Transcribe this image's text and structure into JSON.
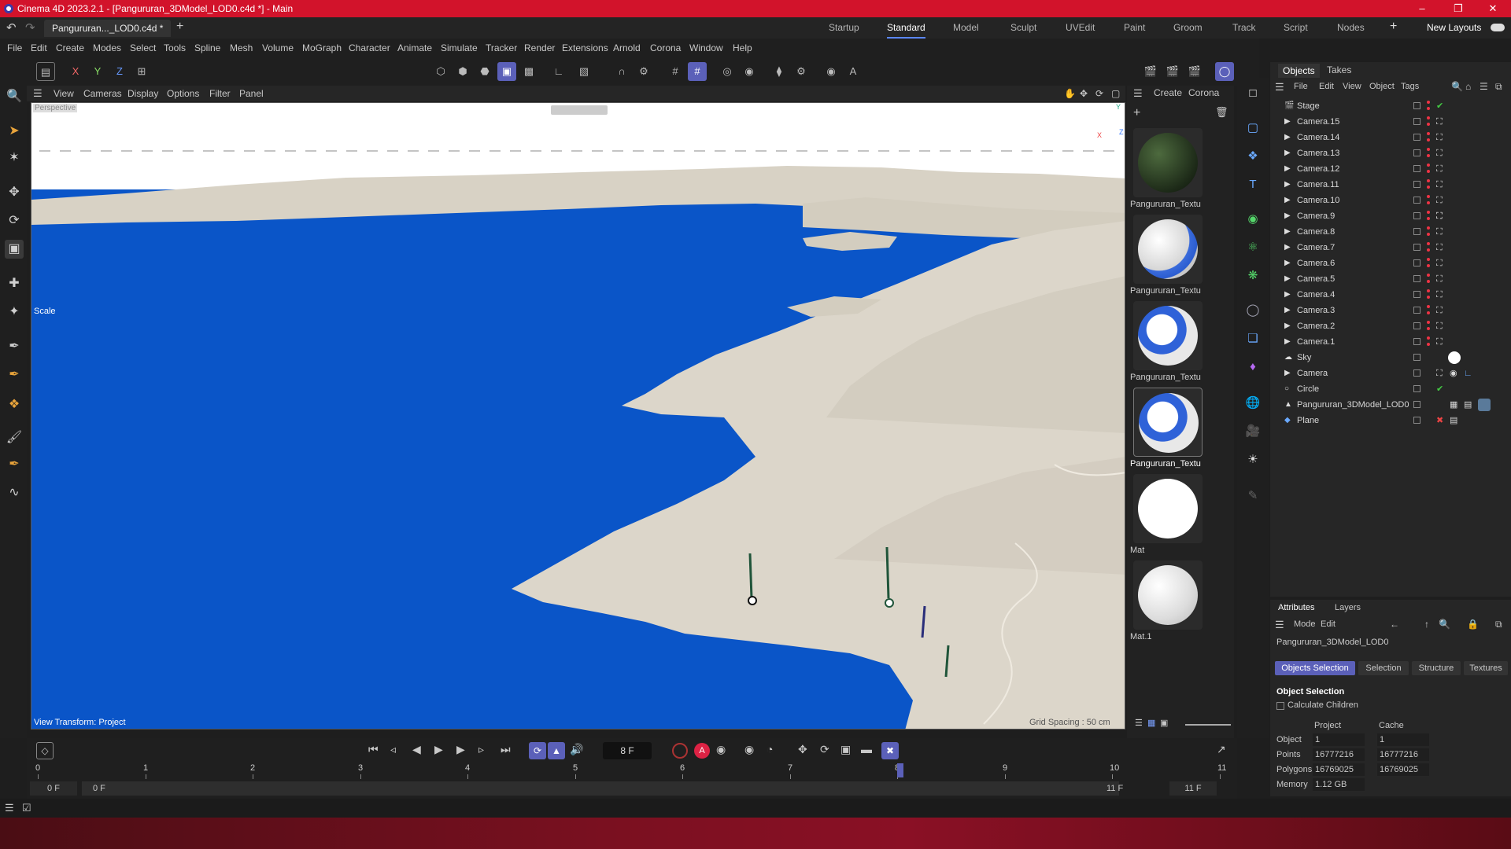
{
  "window": {
    "title": "Cinema 4D 2023.2.1 - [Pangururan_3DModel_LOD0.c4d *] - Main"
  },
  "tabs": {
    "doc_tab": "Pangururan..._LOD0.c4d *"
  },
  "layouts": {
    "items": [
      "Startup",
      "Standard",
      "Model",
      "Sculpt",
      "UVEdit",
      "Paint",
      "Groom",
      "Track",
      "Script",
      "Nodes"
    ],
    "active": "Standard",
    "new_layouts": "New Layouts"
  },
  "menu": {
    "items": [
      "File",
      "Edit",
      "Create",
      "Modes",
      "Select",
      "Tools",
      "Spline",
      "Mesh",
      "Volume",
      "MoGraph",
      "Character",
      "Animate",
      "Simulate",
      "Tracker",
      "Render",
      "Extensions",
      "Arnold",
      "Corona",
      "Window",
      "Help"
    ]
  },
  "axis_toolbar": {
    "x": "X",
    "y": "Y",
    "z": "Z"
  },
  "viewport": {
    "menu": [
      "View",
      "Cameras",
      "Display",
      "Options",
      "Filter",
      "Panel"
    ],
    "camera_label": "Perspective",
    "hud_label": "Scale",
    "view_transform": "View Transform: Project",
    "grid_spacing": "Grid Spacing : 50 cm",
    "axis": {
      "x": "X",
      "y": "Y",
      "z": "Z"
    }
  },
  "materials": {
    "menu": [
      "Create",
      "Corona"
    ],
    "items": [
      {
        "label": "Pangururan_Textu",
        "type": "terrain"
      },
      {
        "label": "Pangururan_Textu",
        "type": "map"
      },
      {
        "label": "Pangururan_Textu",
        "type": "map"
      },
      {
        "label": "Pangururan_Textu",
        "type": "map-selected"
      },
      {
        "label": "Mat",
        "type": "white"
      },
      {
        "label": "Mat.1",
        "type": "white"
      }
    ]
  },
  "objects_panel": {
    "tabs": [
      "Objects",
      "Takes"
    ],
    "menu": [
      "File",
      "Edit",
      "View",
      "Object",
      "Tags"
    ],
    "rows": [
      {
        "name": "Stage",
        "icon": "stage-icon",
        "tag": "check"
      },
      {
        "name": "Camera.15",
        "icon": "camera-icon",
        "tag": "target"
      },
      {
        "name": "Camera.14",
        "icon": "camera-icon",
        "tag": "target"
      },
      {
        "name": "Camera.13",
        "icon": "camera-icon",
        "tag": "target"
      },
      {
        "name": "Camera.12",
        "icon": "camera-icon",
        "tag": "target"
      },
      {
        "name": "Camera.11",
        "icon": "camera-icon",
        "tag": "target"
      },
      {
        "name": "Camera.10",
        "icon": "camera-icon",
        "tag": "target"
      },
      {
        "name": "Camera.9",
        "icon": "camera-icon",
        "tag": "target"
      },
      {
        "name": "Camera.8",
        "icon": "camera-icon",
        "tag": "target"
      },
      {
        "name": "Camera.7",
        "icon": "camera-icon",
        "tag": "target"
      },
      {
        "name": "Camera.6",
        "icon": "camera-icon",
        "tag": "target"
      },
      {
        "name": "Camera.5",
        "icon": "camera-icon",
        "tag": "target"
      },
      {
        "name": "Camera.4",
        "icon": "camera-icon",
        "tag": "target"
      },
      {
        "name": "Camera.3",
        "icon": "camera-icon",
        "tag": "target"
      },
      {
        "name": "Camera.2",
        "icon": "camera-icon",
        "tag": "target"
      },
      {
        "name": "Camera.1",
        "icon": "camera-icon",
        "tag": "target"
      },
      {
        "name": "Sky",
        "icon": "sky-icon",
        "tag": "sphere"
      },
      {
        "name": "Camera",
        "icon": "camera-icon",
        "tag": "target"
      },
      {
        "name": "Circle",
        "icon": "circle-icon",
        "tag": "check"
      },
      {
        "name": "Pangururan_3DModel_LOD0",
        "icon": "polygon-icon",
        "tag": "material"
      },
      {
        "name": "Plane",
        "icon": "plane-icon",
        "tag": "cross"
      }
    ]
  },
  "attributes": {
    "tabs": [
      "Attributes",
      "Layers"
    ],
    "menu": [
      "Mode",
      "Edit"
    ],
    "object_name": "Pangururan_3DModel_LOD0",
    "subtabs": [
      "Objects Selection",
      "Selection",
      "Structure",
      "Textures"
    ],
    "active_subtab": "Objects Selection",
    "section": "Object Selection",
    "calc_children": "Calculate Children",
    "col_project": "Project",
    "col_cache": "Cache",
    "rows": [
      {
        "label": "Object",
        "project": "1",
        "cache": "1"
      },
      {
        "label": "Points",
        "project": "16777216",
        "cache": "16777216"
      },
      {
        "label": "Polygons",
        "project": "16769025",
        "cache": "16769025"
      },
      {
        "label": "Memory",
        "project": "1.12 GB",
        "cache": ""
      }
    ]
  },
  "timeline": {
    "current_frame": "8 F",
    "ticks": [
      "0",
      "1",
      "2",
      "3",
      "4",
      "5",
      "6",
      "7",
      "8",
      "9",
      "10",
      "11"
    ],
    "range_start": "0 F",
    "range_start2": "0 F",
    "range_end": "11 F",
    "range_end2": "11 F",
    "playhead_frame": 8,
    "max_frame": 11
  },
  "colors": {
    "titlebar": "#d2132b",
    "accent": "#5b60b9",
    "water": "#0a55c8",
    "terrain": "#d9d3c7"
  }
}
